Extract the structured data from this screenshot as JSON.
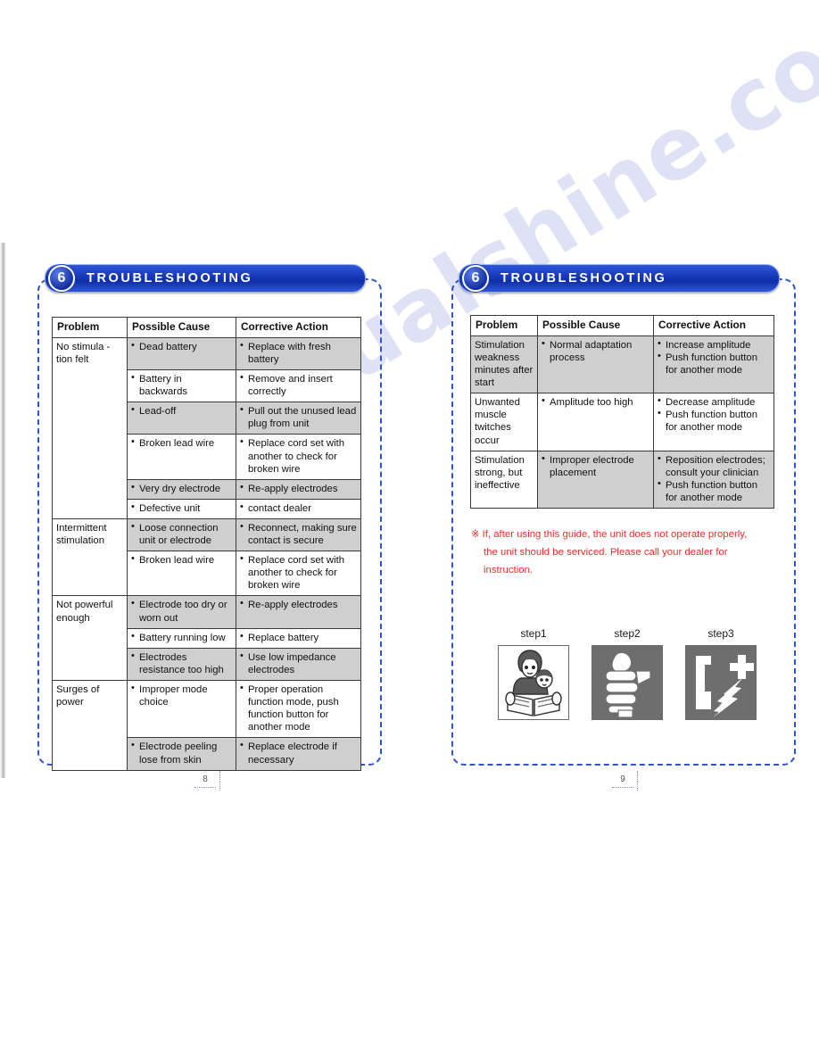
{
  "document": {
    "watermark": "manualshine.com"
  },
  "left_page": {
    "banner": {
      "number": "6",
      "title": "TROUBLESHOOTING"
    },
    "page_number": "8",
    "table": {
      "headers": [
        "Problem",
        "Possible Cause",
        "Corrective Action"
      ],
      "groups": [
        {
          "problem": "No stimula - tion felt",
          "rows": [
            {
              "cause": "Dead battery",
              "action": "Replace with fresh battery",
              "shaded": true
            },
            {
              "cause": "Battery in backwards",
              "action": "Remove and insert correctly",
              "shaded": false
            },
            {
              "cause": "Lead-off",
              "action": "Pull out the unused lead plug from unit",
              "shaded": true
            },
            {
              "cause": "Broken lead wire",
              "action": "Replace cord set with another to check for broken wire",
              "shaded": false
            },
            {
              "cause": "Very dry electrode",
              "action": "Re-apply electrodes",
              "shaded": true
            },
            {
              "cause": "Defective unit",
              "action": "contact dealer",
              "shaded": false
            }
          ]
        },
        {
          "problem": "Intermittent stimulation",
          "rows": [
            {
              "cause": "Loose connection unit or electrode",
              "action": "Reconnect, making sure contact is secure",
              "shaded": true
            },
            {
              "cause": "Broken lead wire",
              "action": "Replace cord set with another to check for broken wire",
              "shaded": false
            }
          ]
        },
        {
          "problem": "Not powerful enough",
          "rows": [
            {
              "cause": "Electrode too dry or worn out",
              "action": "Re-apply electrodes",
              "shaded": true
            },
            {
              "cause": "Battery running low",
              "action": "Replace battery",
              "shaded": false
            },
            {
              "cause": "Electrodes resistance too high",
              "action": "Use low impedance electrodes",
              "shaded": true
            }
          ]
        },
        {
          "problem": "Surges of power",
          "rows": [
            {
              "cause": "Improper  mode choice",
              "action": "Proper  operation function mode, push function button for another mode",
              "shaded": false
            },
            {
              "cause": "Electrode peeling lose from skin",
              "action": "Replace electrode if necessary",
              "shaded": true
            }
          ]
        }
      ]
    }
  },
  "right_page": {
    "banner": {
      "number": "6",
      "title": "TROUBLESHOOTING"
    },
    "page_number": "9",
    "table": {
      "headers": [
        "Problem",
        "Possible Cause",
        "Corrective Action"
      ],
      "rows": [
        {
          "problem": "Stimulation weakness minutes after start",
          "causes": [
            "Normal adaptation process"
          ],
          "actions": [
            "Increase amplitude",
            "Push function button for another mode"
          ],
          "shaded": true
        },
        {
          "problem": "Unwanted muscle twitches occur",
          "causes": [
            "Amplitude too high"
          ],
          "actions": [
            "Decrease amplitude",
            "Push function button for another mode"
          ],
          "shaded": false
        },
        {
          "problem": "Stimulation strong, but ineffective",
          "causes": [
            "Improper electrode placement"
          ],
          "actions": [
            "Reposition electrodes; consult your clinician",
            "Push function button for another mode"
          ],
          "shaded": true
        }
      ]
    },
    "note": {
      "mark": "※",
      "line1": "If, after using this guide, the unit does not operate properly,",
      "line2": "the unit should be serviced. Please call your dealer for",
      "line3": "instruction."
    },
    "steps": [
      {
        "label": "step1",
        "icon": "read-manual-icon"
      },
      {
        "label": "step2",
        "icon": "hand-electrode-icon"
      },
      {
        "label": "step3",
        "icon": "emergency-phone-icon"
      }
    ]
  }
}
